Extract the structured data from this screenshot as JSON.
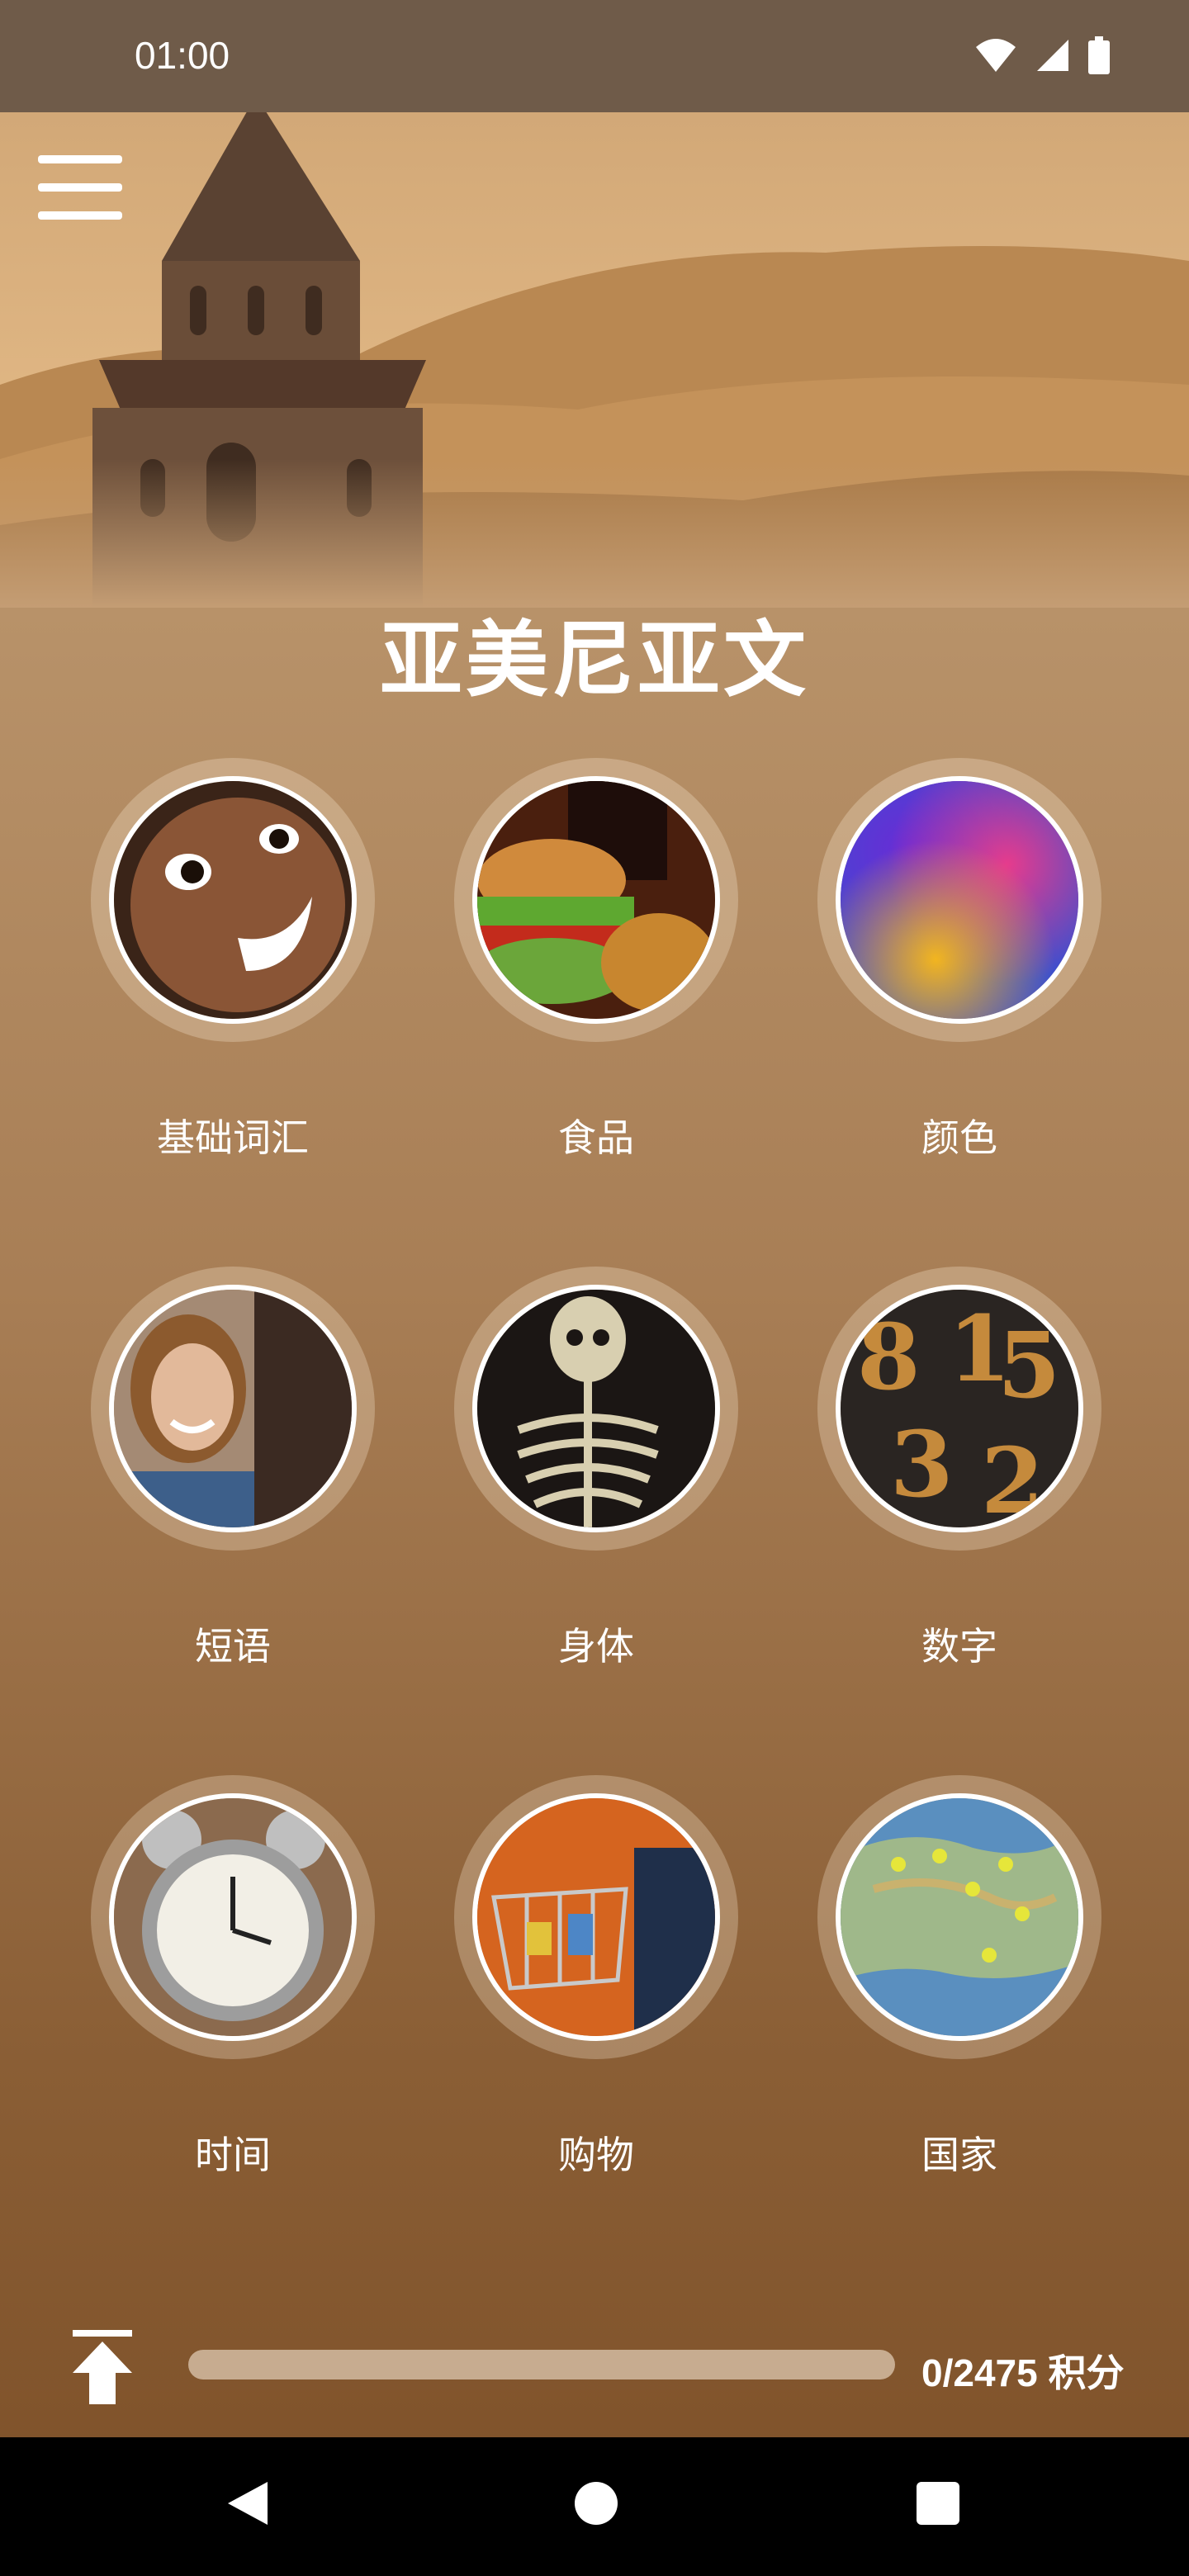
{
  "status_bar": {
    "time": "01:00"
  },
  "app": {
    "title": "亚美尼亚文"
  },
  "categories": [
    {
      "label": "基础词汇",
      "image": "smiling-child-photo"
    },
    {
      "label": "食品",
      "image": "burger-and-soda-photo"
    },
    {
      "label": "颜色",
      "image": "color-powder-photo"
    },
    {
      "label": "短语",
      "image": "smiling-woman-photo"
    },
    {
      "label": "身体",
      "image": "skeleton-photo"
    },
    {
      "label": "数字",
      "image": "wooden-numbers-photo"
    },
    {
      "label": "时间",
      "image": "alarm-clock-photo"
    },
    {
      "label": "购物",
      "image": "shopping-cart-photo"
    },
    {
      "label": "国家",
      "image": "map-with-pins-photo"
    }
  ],
  "footer": {
    "points": "0/2475 积分",
    "progress": 0
  },
  "colors": {
    "accent": "#ffffff",
    "background_top": "#c6a37c",
    "background_bottom": "#7d5028"
  }
}
